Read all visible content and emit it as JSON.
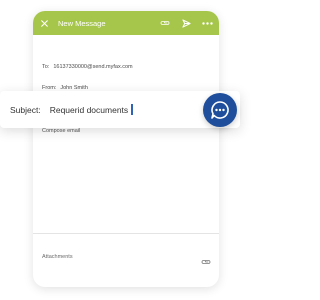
{
  "header": {
    "title": "New Message",
    "icons": [
      "close-icon",
      "attachment-icon",
      "send-icon",
      "more-icon"
    ]
  },
  "fields": {
    "to_label": "To:",
    "to_value": "16137330000@send.myfax.com",
    "from_label": "From:",
    "from_value": "John Smith",
    "body_placeholder": "Compose email"
  },
  "subject": {
    "label": "Subject:",
    "value": "Requerid documents"
  },
  "footer": {
    "attachments_label": "Attachments"
  },
  "colors": {
    "header": "#a6c64b",
    "chat_bubble": "#1f4f9c",
    "cursor": "#2e63b6"
  }
}
